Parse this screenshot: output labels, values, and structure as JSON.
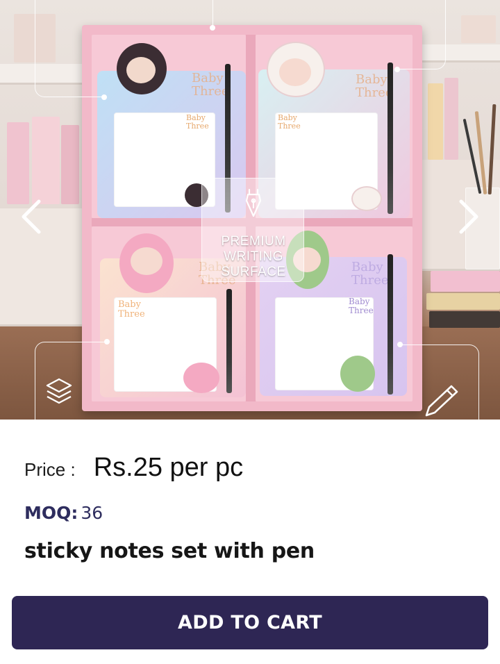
{
  "carousel": {
    "badge_lines": [
      "PREMIUM",
      "WRITING",
      "SURFACE"
    ],
    "pad_brand_small": [
      "Baby",
      "Three"
    ],
    "pad_brand_large": [
      "Baby",
      "Three"
    ],
    "prev_icon": "chevron-left-icon",
    "next_icon": "chevron-right-icon",
    "badge_icon": "fountain-pen-nib-icon",
    "layers_icon": "layers-icon",
    "pen_icon": "pen-icon"
  },
  "product": {
    "price_label": "Price :",
    "price_value": "Rs.25 per pc",
    "moq_label": "MOQ:",
    "moq_value": "36",
    "title": "sticky notes set with pen"
  },
  "actions": {
    "add_to_cart_label": "ADD TO CART"
  },
  "colors": {
    "button_bg": "#2e2654",
    "moq_text": "#2e2d5e",
    "box_pink": "#f2b9c9"
  }
}
